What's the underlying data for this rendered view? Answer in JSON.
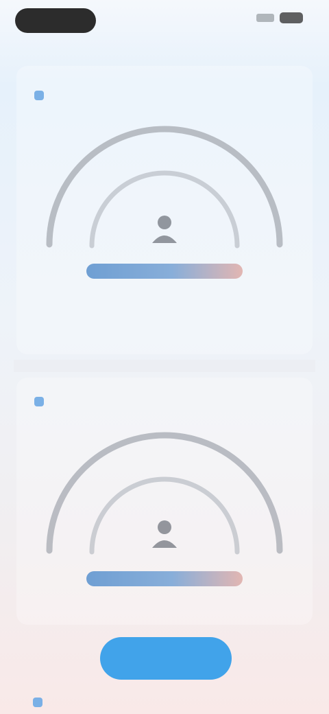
{
  "status_bar": {
    "time": "",
    "signal_icon": "signal-icon",
    "battery_icon": "battery-icon"
  },
  "section_1": {
    "title": "",
    "icon": "chart-square-icon",
    "center_icon": "person-icon",
    "scale_label": ""
  },
  "section_2": {
    "title": "",
    "icon": "chart-square-icon",
    "center_icon": "person-icon",
    "scale_label": ""
  },
  "primary_button": {
    "label": ""
  },
  "section_3": {
    "title": "",
    "icon": "chart-square-icon"
  },
  "colors": {
    "accent_blue": "#41a3ea",
    "gauge_arc": "#a6aab2",
    "scale_start": "#6f9fd3",
    "scale_end": "#e2b6b2"
  }
}
